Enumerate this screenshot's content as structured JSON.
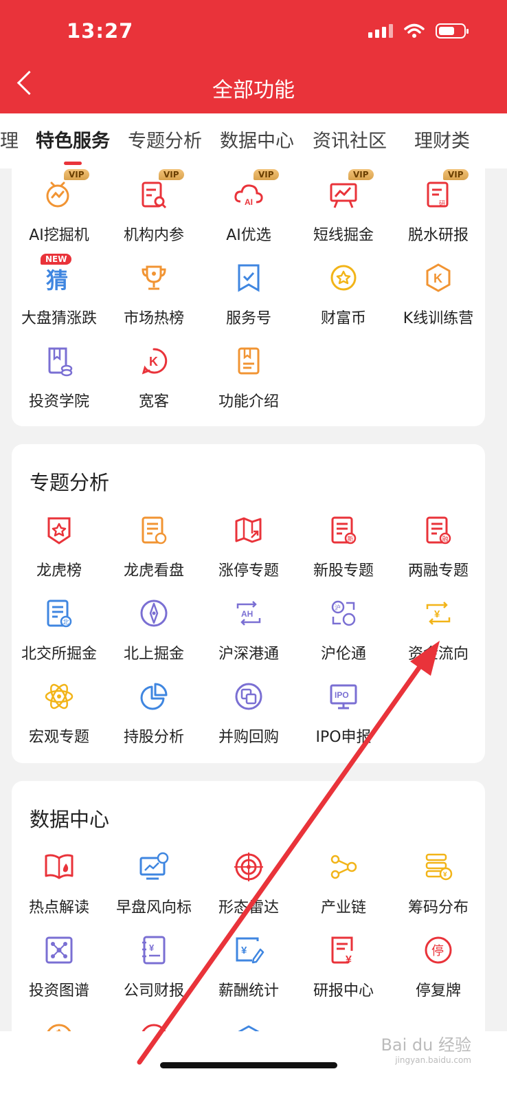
{
  "status_bar": {
    "time": "13:27"
  },
  "header": {
    "title": "全部功能"
  },
  "tabs": [
    "理",
    "特色服务",
    "专题分析",
    "数据中心",
    "资讯社区",
    "理财类"
  ],
  "featured": {
    "items": [
      {
        "label": "AI挖掘机",
        "badge": "VIP",
        "icon": "ai-digger-icon"
      },
      {
        "label": "机构内参",
        "badge": "VIP",
        "icon": "report-search-icon"
      },
      {
        "label": "AI优选",
        "badge": "VIP",
        "icon": "ai-cloud-icon"
      },
      {
        "label": "短线掘金",
        "badge": "VIP",
        "icon": "chart-board-icon"
      },
      {
        "label": "脱水研报",
        "badge": "VIP",
        "icon": "research-doc-icon"
      },
      {
        "label": "大盘猜涨跌",
        "badge": "NEW",
        "glyph": "猜",
        "icon": "guess-icon"
      },
      {
        "label": "市场热榜",
        "icon": "trophy-icon"
      },
      {
        "label": "服务号",
        "icon": "bookmark-check-icon"
      },
      {
        "label": "财富币",
        "icon": "coin-star-icon"
      },
      {
        "label": "K线训练营",
        "glyph": "K",
        "icon": "k-hexagon-icon"
      },
      {
        "label": "投资学院",
        "icon": "book-coin-icon"
      },
      {
        "label": "宽客",
        "glyph": "K",
        "icon": "quant-icon"
      },
      {
        "label": "功能介绍",
        "icon": "guide-book-icon"
      }
    ]
  },
  "topic": {
    "title": "专题分析",
    "items": [
      {
        "label": "龙虎榜",
        "icon": "shield-star-icon"
      },
      {
        "label": "龙虎看盘",
        "icon": "doc-coin-icon"
      },
      {
        "label": "涨停专题",
        "icon": "map-up-icon"
      },
      {
        "label": "新股专题",
        "glyph": "新",
        "icon": "doc-new-icon"
      },
      {
        "label": "两融专题",
        "glyph": "融",
        "icon": "doc-margin-icon"
      },
      {
        "label": "北交所掘金",
        "glyph": "北",
        "icon": "doc-north-icon"
      },
      {
        "label": "北上掘金",
        "icon": "compass-icon"
      },
      {
        "label": "沪深港通",
        "glyph": "AH",
        "icon": "ah-exchange-icon"
      },
      {
        "label": "沪伦通",
        "glyph": "沪",
        "icon": "exchange-london-icon"
      },
      {
        "label": "资金流向",
        "glyph": "¥",
        "icon": "money-flow-icon"
      },
      {
        "label": "宏观专题",
        "icon": "atom-icon"
      },
      {
        "label": "持股分析",
        "icon": "pie-chart-icon"
      },
      {
        "label": "并购回购",
        "icon": "merge-icon"
      },
      {
        "label": "IPO申报",
        "glyph": "IPO",
        "icon": "ipo-monitor-icon"
      }
    ]
  },
  "data_center": {
    "title": "数据中心",
    "items": [
      {
        "label": "热点解读",
        "icon": "book-fire-icon"
      },
      {
        "label": "早盘风向标",
        "icon": "screen-chart-icon"
      },
      {
        "label": "形态雷达",
        "icon": "radar-icon"
      },
      {
        "label": "产业链",
        "icon": "chain-nodes-icon"
      },
      {
        "label": "筹码分布",
        "glyph": "¥",
        "icon": "coin-stack-icon"
      },
      {
        "label": "投资图谱",
        "icon": "graph-nodes-icon"
      },
      {
        "label": "公司财报",
        "glyph": "¥",
        "icon": "finance-report-icon"
      },
      {
        "label": "薪酬统计",
        "glyph": "¥",
        "icon": "salary-icon"
      },
      {
        "label": "研报中心",
        "glyph": "¥",
        "icon": "research-center-icon"
      },
      {
        "label": "停复牌",
        "glyph": "停",
        "icon": "suspend-icon"
      }
    ]
  },
  "watermark": {
    "text": "Bai du 经验",
    "sub": "jingyan.baidu.com"
  },
  "colors": {
    "brand_red": "#e9333a",
    "orange": "#f19433",
    "purple": "#7a6fd3",
    "blue": "#3f86e0",
    "yellow": "#f2b418",
    "vip_gold": "#e0ac5a"
  }
}
